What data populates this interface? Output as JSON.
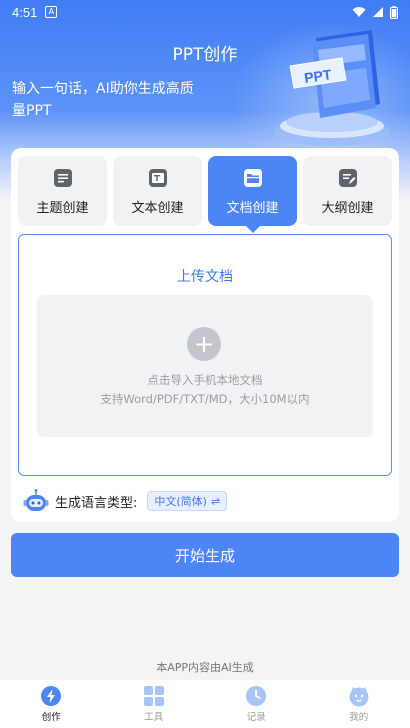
{
  "status_bar": {
    "time": "4:51",
    "notif_badge": "A"
  },
  "header": {
    "title": "PPT创作",
    "slogan": "输入一句话，AI助你生成高质量PPT",
    "illustration_text": "PPT"
  },
  "tabs": [
    {
      "label": "主题创建",
      "icon": "topic-icon",
      "active": false
    },
    {
      "label": "文本创建",
      "icon": "text-icon",
      "active": false
    },
    {
      "label": "文档创建",
      "icon": "folder-icon",
      "active": true
    },
    {
      "label": "大纲创建",
      "icon": "outline-icon",
      "active": false
    }
  ],
  "upload": {
    "title": "上传文档",
    "plus": "+",
    "hint1": "点击导入手机本地文档",
    "hint2": "支持Word/PDF/TXT/MD，大小10M以内"
  },
  "language": {
    "label": "生成语言类型:",
    "value": "中文(简体)",
    "swap": "⇌"
  },
  "start_button": "开始生成",
  "ai_note": "本APP内容由AI生成",
  "bottom_nav": [
    {
      "label": "创作",
      "icon": "create-icon",
      "active": true
    },
    {
      "label": "工具",
      "icon": "tools-icon",
      "active": false
    },
    {
      "label": "记录",
      "icon": "history-icon",
      "active": false
    },
    {
      "label": "我的",
      "icon": "profile-icon",
      "active": false
    }
  ],
  "colors": {
    "primary": "#4c85f6",
    "accent_text": "#3d79f2",
    "background": "#f3f4f6"
  }
}
